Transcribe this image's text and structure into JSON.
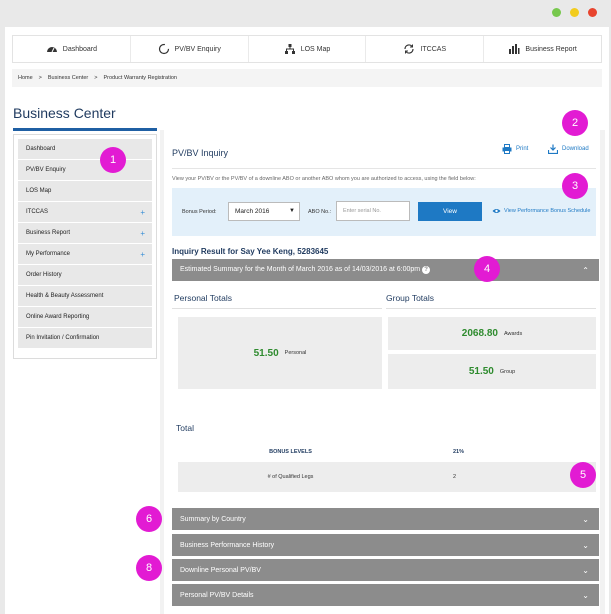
{
  "window": {
    "dot_colors": [
      "#77c84d",
      "#f2cc1d",
      "#e8442e"
    ]
  },
  "topnav": [
    {
      "label": "Dashboard",
      "icon": "dashboard-icon"
    },
    {
      "label": "PV/BV Enquiry",
      "icon": "refresh-circle-icon"
    },
    {
      "label": "LOS Map",
      "icon": "org-chart-icon"
    },
    {
      "label": "ITCCAS",
      "icon": "sync-icon"
    },
    {
      "label": "Business Report",
      "icon": "bar-chart-icon"
    }
  ],
  "breadcrumb": {
    "home": "Home",
    "sep": ">",
    "center": "Business Center",
    "current": "Product Warranty Registration"
  },
  "page_title": "Business Center",
  "sidebar": [
    {
      "label": "Dashboard",
      "plus": ""
    },
    {
      "label": "PV/BV Enquiry",
      "plus": ""
    },
    {
      "label": "LOS Map",
      "plus": ""
    },
    {
      "label": "ITCCAS",
      "plus": "+"
    },
    {
      "label": "Business Report",
      "plus": "+"
    },
    {
      "label": "My Performance",
      "plus": "+"
    },
    {
      "label": "Order History",
      "plus": ""
    },
    {
      "label": "Health & Beauty Assessment",
      "plus": ""
    },
    {
      "label": "Online Award Reporting",
      "plus": ""
    },
    {
      "label": "Pin Invitation / Confirmation",
      "plus": ""
    }
  ],
  "inquiry": {
    "title": "PV/BV Inquiry",
    "print": "Print",
    "download": "Download",
    "description": "View your PV/BV or the PV/BV of a downline ABO or another ABO whom you are authorized to access, using the field below:",
    "bonus_period_label": "Bonus Period:",
    "bonus_period_value": "March 2016",
    "abo_label": "ABO No.:",
    "abo_placeholder": "Enter serial No.",
    "view_button": "View",
    "schedule_link": "View Performance Bonus Schedule"
  },
  "result": {
    "title": "Inquiry Result for Say Yee Keng, 5283645",
    "summary_header": "Estimated Summary for the Month of March 2016 as of 14/03/2016 at 6:00pm",
    "personal_totals": "Personal Totals",
    "group_totals": "Group Totals",
    "personal_value": "51.50",
    "personal_label": "Personal",
    "awards_value": "2068.80",
    "awards_label": "Awards",
    "group_value": "51.50",
    "group_label": "Group",
    "total_title": "Total",
    "table": [
      {
        "label": "BONUS LEVELS",
        "value": "21%"
      },
      {
        "label": "# of Qualified Legs",
        "value": "2"
      }
    ]
  },
  "accordions": [
    "Summary by Country",
    "Business Performance History",
    "Downline Personal PV/BV",
    "Personal PV/BV Details"
  ],
  "badges": [
    "1",
    "2",
    "3",
    "4",
    "5",
    "6",
    "8"
  ],
  "colors": {
    "accent": "#1e79c4",
    "badge": "#e21bd3",
    "green": "#2e8b2e",
    "header_gray": "#8c8c8c"
  }
}
